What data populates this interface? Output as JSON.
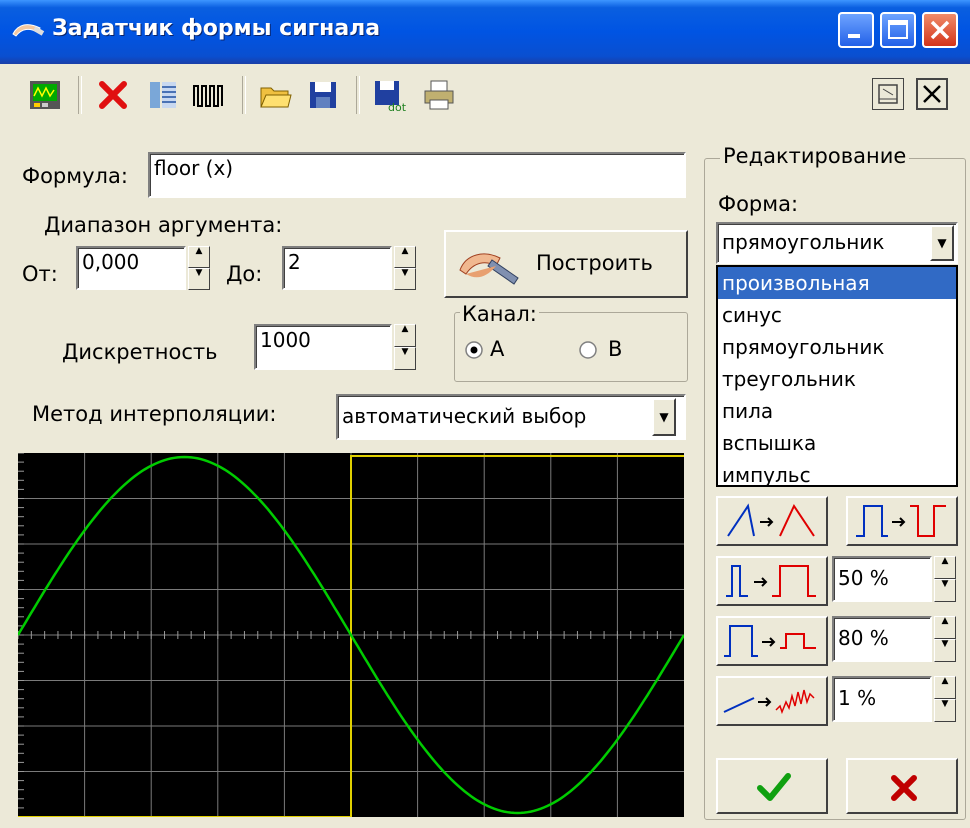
{
  "window": {
    "title": "Задатчик формы сигнала",
    "controls": [
      "minimize-icon",
      "maximize-icon",
      "close-icon"
    ]
  },
  "toolbar": {
    "icons": [
      "oscilloscope-icon",
      "delete-icon",
      "table-icon",
      "pulse-train-icon",
      "open-folder-icon",
      "save-icon",
      "save-as-icon",
      "print-icon"
    ],
    "right_icons": [
      "window-icon",
      "close-icon"
    ]
  },
  "formula": {
    "label": "Формула:",
    "value": "floor (x)"
  },
  "range": {
    "label": "Диапазон аргумента:",
    "from_label": "От:",
    "from_value": "0,000",
    "to_label": "До:",
    "to_value": "2"
  },
  "build_button": {
    "label": "Построить",
    "icon": "hand-pen-icon"
  },
  "discreteness": {
    "label": "Дискретность",
    "value": "1000"
  },
  "channel": {
    "label": "Канал:",
    "option_a": "A",
    "option_b": "B",
    "selected": "A"
  },
  "interpolation": {
    "label": "Метод интерполяции:",
    "value": "автоматический выбор"
  },
  "editing": {
    "title": "Редактирование",
    "form_label": "Форма:",
    "form_value": "прямоугольник",
    "options": [
      "произвольная",
      "синус",
      "прямоугольник",
      "треугольник",
      "пила",
      "вспышка",
      "импульс"
    ],
    "highlighted_option": "произвольная",
    "duty1": "50 %",
    "duty2": "80 %",
    "noise": "1 %"
  },
  "colors": {
    "sine": "#00cc00",
    "square": "#e0d000",
    "grid": "#808080",
    "titlebar": "#0054e3",
    "selection": "#316ac5"
  }
}
